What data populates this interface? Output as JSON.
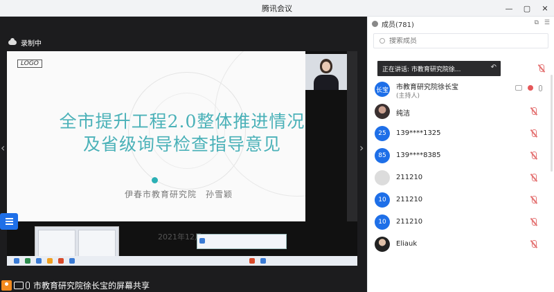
{
  "window": {
    "title": "腾讯会议",
    "controls": [
      "—",
      "▢",
      "✕"
    ]
  },
  "recording": {
    "label": "录制中"
  },
  "slide": {
    "logo": "LOGO",
    "title_line1": "全市提升工程2.0整体推进情况",
    "title_line2": "及省级询导检查指导意见",
    "author": "伊春市教育研究院　孙雪颖",
    "date_partial": "2021年12月"
  },
  "share_bar": {
    "label": "市教育研究院徐长宝的屏幕共享"
  },
  "members_panel": {
    "title": "成员(781)",
    "search_placeholder": "搜索成员",
    "speaking": "正在讲话: 市教育研究院徐...",
    "members": [
      {
        "avatar": "长宝",
        "name": "市教育研究院徐长宝",
        "role": "(主持人)",
        "avatar_style": "blue"
      },
      {
        "avatar": "",
        "name": "纯洁",
        "avatar_style": "photo"
      },
      {
        "avatar": "25",
        "name": "139****1325",
        "avatar_style": "blue"
      },
      {
        "avatar": "85",
        "name": "139****8385",
        "avatar_style": "blue"
      },
      {
        "avatar": "",
        "name": "211210",
        "avatar_style": "gray"
      },
      {
        "avatar": "10",
        "name": "211210",
        "avatar_style": "blue"
      },
      {
        "avatar": "10",
        "name": "211210",
        "avatar_style": "blue"
      },
      {
        "avatar": "",
        "name": "Eliauk",
        "avatar_style": "photo2"
      }
    ]
  },
  "colors": {
    "accent": "#1e6fe8",
    "slide_title": "#4ab1b8",
    "muted_red": "#e47373"
  }
}
